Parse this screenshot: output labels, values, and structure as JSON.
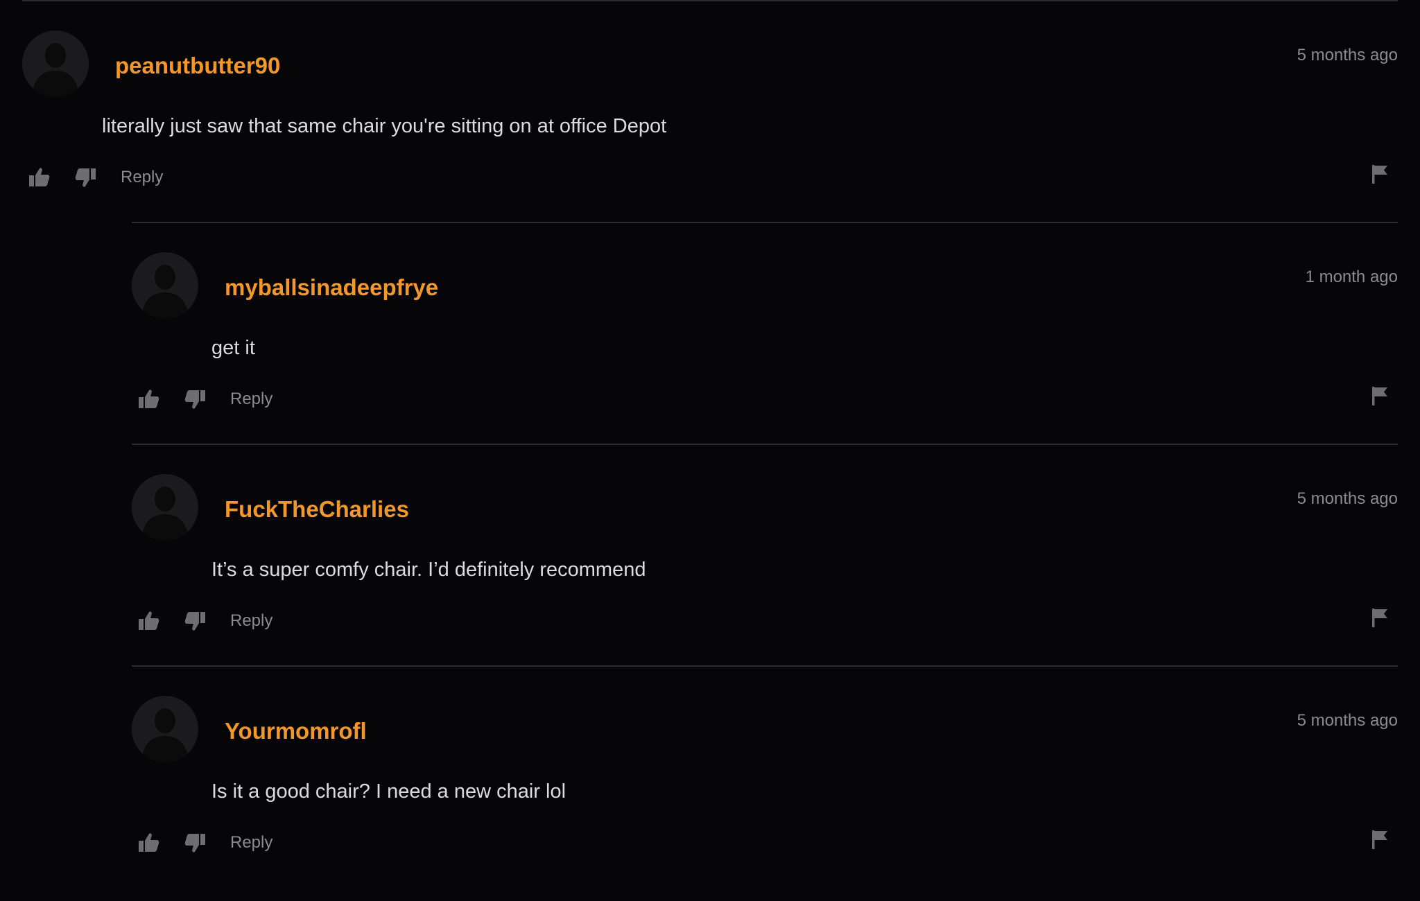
{
  "colors": {
    "background": "#060608",
    "username": "#f2982b",
    "body_text": "#dcdcde",
    "meta_text": "#8c8c8e",
    "icon": "#6e6e70",
    "divider": "#2c2c2e"
  },
  "icons": {
    "avatar": "default-user-silhouette-icon",
    "like": "thumbs-up-icon",
    "dislike": "thumbs-down-icon",
    "flag": "flag-icon"
  },
  "comments": [
    {
      "username": "peanutbutter90",
      "timestamp": "5 months ago",
      "text": "literally just saw that same chair you're sitting on at office Depot",
      "reply_label": "Reply",
      "is_reply": false
    },
    {
      "username": "myballsinadeepfrye",
      "timestamp": "1 month ago",
      "text": "get it",
      "reply_label": "Reply",
      "is_reply": true
    },
    {
      "username": "FuckTheCharlies",
      "timestamp": "5 months ago",
      "text": "It’s a super comfy chair. I’d definitely recommend",
      "reply_label": "Reply",
      "is_reply": true
    },
    {
      "username": "Yourmomrofl",
      "timestamp": "5 months ago",
      "text": "Is it a good chair? I need a new chair lol",
      "reply_label": "Reply",
      "is_reply": true
    }
  ]
}
